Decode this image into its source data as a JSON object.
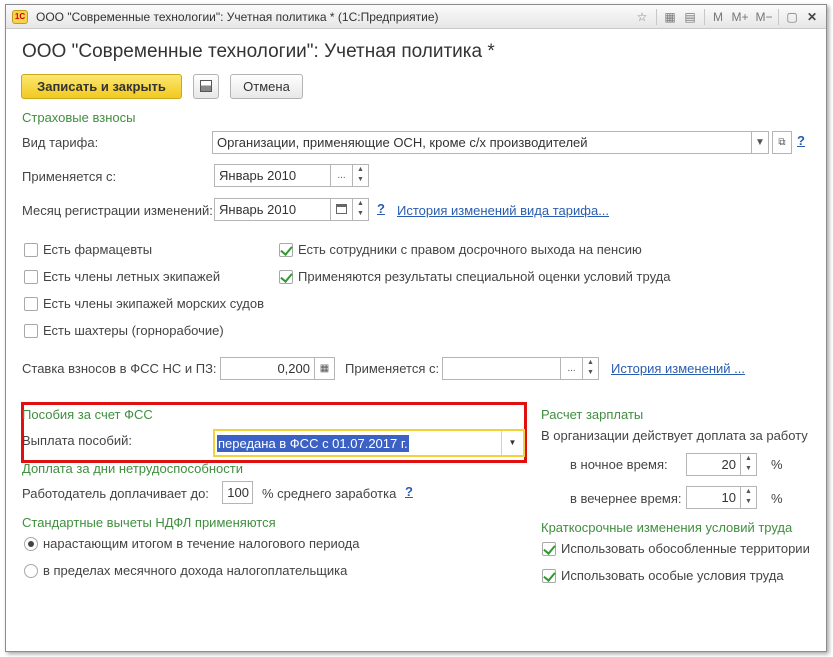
{
  "window": {
    "title": "ООО \"Современные технологии\": Учетная политика * (1С:Предприятие)",
    "toolbar_icons": [
      "favorite-icon",
      "calendar-icon",
      "memory-m",
      "memory-m-plus",
      "memory-m-minus",
      "restore-icon",
      "close-icon"
    ],
    "memory_labels": [
      "M",
      "M+",
      "M−"
    ],
    "restore_glyph": "▢",
    "close_glyph": "✕",
    "logo_text": "1С"
  },
  "form": {
    "heading": "ООО \"Современные технологии\": Учетная политика *",
    "save_close_label": "Записать и закрыть",
    "cancel_label": "Отмена"
  },
  "insurance": {
    "section_title": "Страховые взносы",
    "tariff_label": "Вид тарифа:",
    "tariff_value": "Организации, применяющие ОСН, кроме с/х производителей",
    "applies_from_label": "Применяется с:",
    "applies_from_value": "Январь 2010",
    "reg_month_label": "Месяц регистрации изменений:",
    "reg_month_value": "Январь 2010",
    "tariff_history_link": "История изменений вида тарифа...",
    "help": "?",
    "dots": "...",
    "checkboxes_left": [
      {
        "label": "Есть фармацевты",
        "checked": false
      },
      {
        "label": "Есть члены летных экипажей",
        "checked": false
      },
      {
        "label": "Есть члены экипажей морских судов",
        "checked": false
      },
      {
        "label": "Есть шахтеры (горнорабочие)",
        "checked": false
      }
    ],
    "checkboxes_right": [
      {
        "label": "Есть сотрудники с правом досрочного выхода на пенсию",
        "checked": true
      },
      {
        "label": "Применяются результаты специальной оценки условий труда",
        "checked": true
      }
    ],
    "fss_rate_label": "Ставка взносов в ФСС НС и ПЗ:",
    "fss_rate_value": "0,200",
    "fss_applies_label": "Применяется с:",
    "fss_applies_value": "",
    "fss_history_link": "История изменений ..."
  },
  "benefits": {
    "section_title": "Пособия за счет ФСС",
    "payment_label": "Выплата пособий:",
    "payment_value": "передана в ФСС с 01.07.2017 г."
  },
  "sick_pay": {
    "section_title": "Доплата за дни нетрудоспособности",
    "employer_label": "Работодатель доплачивает до:",
    "employer_value": "100",
    "employer_suffix": "% среднего заработка",
    "help": "?"
  },
  "ndfl": {
    "section_title": "Стандартные вычеты НДФЛ применяются",
    "options": [
      {
        "label": "нарастающим итогом в течение налогового периода",
        "selected": true
      },
      {
        "label": "в пределах месячного дохода налогоплательщика",
        "selected": false
      }
    ]
  },
  "payroll": {
    "section_title": "Расчет зарплаты",
    "night_caption": "В организации действует доплата за работу",
    "night_label": "в ночное время:",
    "night_value": "20",
    "evening_label": "в вечернее время:",
    "evening_value": "10",
    "percent": "%"
  },
  "short_term": {
    "section_title": "Краткосрочные изменения условий труда",
    "options": [
      {
        "label": "Использовать обособленные территории",
        "checked": true
      },
      {
        "label": "Использовать особые условия труда",
        "checked": true
      }
    ]
  }
}
